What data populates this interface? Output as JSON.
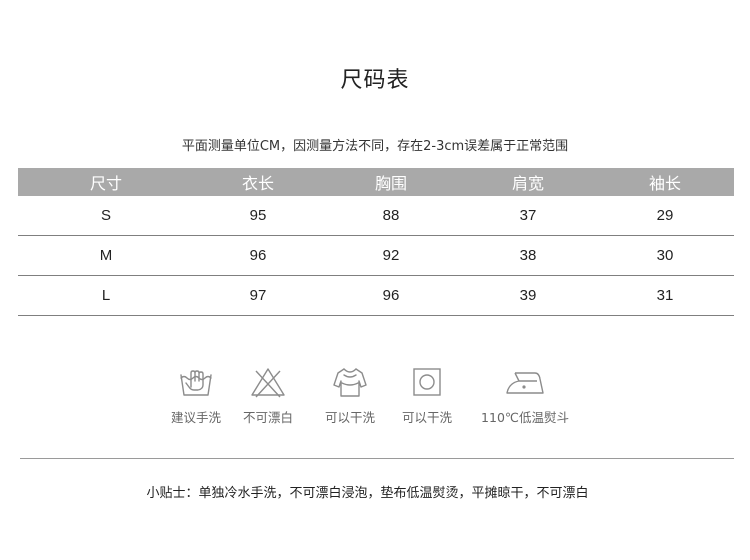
{
  "title": "尺码表",
  "note": "平面测量单位CM，因测量方法不同，存在2-3cm误差属于正常范围",
  "table": {
    "headers": [
      "尺寸",
      "衣长",
      "胸围",
      "肩宽",
      "袖长"
    ],
    "rows": [
      [
        "S",
        "95",
        "88",
        "37",
        "29"
      ],
      [
        "M",
        "96",
        "92",
        "38",
        "30"
      ],
      [
        "L",
        "97",
        "96",
        "39",
        "31"
      ]
    ]
  },
  "care": [
    {
      "icon": "hand-wash-icon",
      "label": "建议手洗"
    },
    {
      "icon": "no-bleach-icon",
      "label": "不可漂白"
    },
    {
      "icon": "line-dry-icon",
      "label": "可以干洗"
    },
    {
      "icon": "tumble-dry-icon",
      "label": "可以干洗"
    },
    {
      "icon": "iron-icon",
      "label": "110℃低温熨斗"
    }
  ],
  "tip": "小贴士：单独冷水手洗，不可漂白浸泡，垫布低温熨烫，平摊晾干，不可漂白",
  "colors": {
    "header_bg": "#a9a9a9",
    "icon_stroke": "#8c8c8c"
  }
}
